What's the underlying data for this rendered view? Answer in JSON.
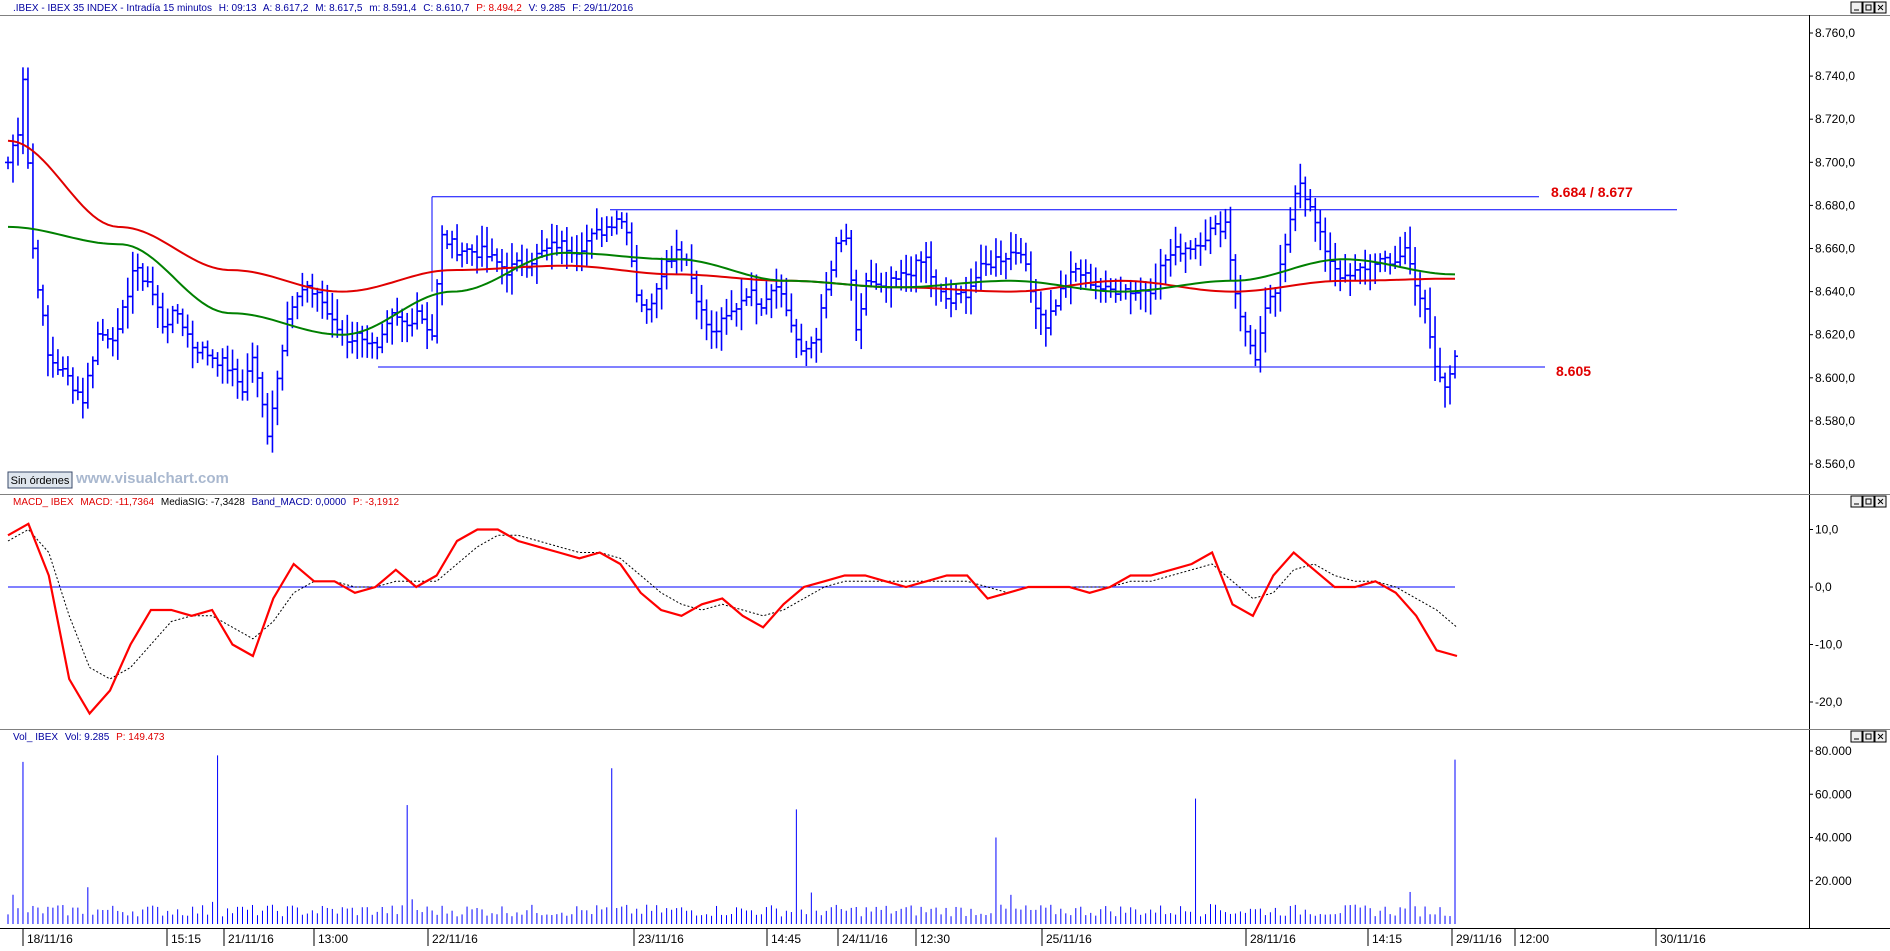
{
  "header": {
    "symbol": ".IBEX - IBEX 35 INDEX - Intradía 15 minutos",
    "h": "H: 09:13",
    "a": "A: 8.617,2",
    "m": "M: 8.617,5",
    "min": "m: 8.591,4",
    "c": "C: 8.610,7",
    "p": "P: 8.494,2",
    "v": "V: 9.285",
    "f": "F: 29/11/2016"
  },
  "watermark": "www.visualchart.com",
  "orders_button": "Sin órdenes",
  "annotations": {
    "resistance_label": "8.684 / 8.677",
    "support_label": "8.605"
  },
  "macd_header": {
    "name": "MACD_ IBEX",
    "macd": "MACD: -11,7364",
    "signal": "MediaSIG: -7,3428",
    "band": "Band_MACD: 0,0000",
    "p": "P: -3,1912"
  },
  "vol_header": {
    "name": "Vol_ IBEX",
    "vol": "Vol: 9.285",
    "p": "P: 149.473"
  },
  "x_labels": [
    "18/11/16",
    "15:15",
    "21/11/16",
    "13:00",
    "22/11/16",
    "23/11/16",
    "14:45",
    "24/11/16",
    "12:30",
    "25/11/16",
    "28/11/16",
    "14:15",
    "29/11/16",
    "12:00",
    "30/11/16"
  ],
  "colors": {
    "price": "#0000ff",
    "ma_long": "#e00000",
    "ma_short": "#008000",
    "macd": "#ff0000",
    "signal": "#000000",
    "annotation": "#e00000"
  },
  "chart_data": [
    {
      "type": "ohlc",
      "name": "IBEX 35 intraday 15 min",
      "ylim": [
        8550,
        8770
      ],
      "yticks": [
        "8.560,0",
        "8.580,0",
        "8.600,0",
        "8.620,0",
        "8.640,0",
        "8.660,0",
        "8.680,0",
        "8.700,0",
        "8.720,0",
        "8.740,0",
        "8.760,0"
      ],
      "anchors": [
        {
          "i": 0,
          "c": 8700
        },
        {
          "i": 2,
          "c": 8715
        },
        {
          "i": 3,
          "c": 8740
        },
        {
          "i": 5,
          "c": 8660
        },
        {
          "i": 8,
          "c": 8610
        },
        {
          "i": 12,
          "c": 8600
        },
        {
          "i": 15,
          "c": 8590
        },
        {
          "i": 18,
          "c": 8620
        },
        {
          "i": 22,
          "c": 8620
        },
        {
          "i": 25,
          "c": 8650
        },
        {
          "i": 28,
          "c": 8645
        },
        {
          "i": 31,
          "c": 8625
        },
        {
          "i": 34,
          "c": 8630
        },
        {
          "i": 37,
          "c": 8615
        },
        {
          "i": 41,
          "c": 8610
        },
        {
          "i": 44,
          "c": 8605
        },
        {
          "i": 47,
          "c": 8595
        },
        {
          "i": 49,
          "c": 8610
        },
        {
          "i": 52,
          "c": 8575
        },
        {
          "i": 54,
          "c": 8600
        },
        {
          "i": 56,
          "c": 8630
        },
        {
          "i": 59,
          "c": 8640
        },
        {
          "i": 62,
          "c": 8640
        },
        {
          "i": 65,
          "c": 8625
        },
        {
          "i": 68,
          "c": 8618
        },
        {
          "i": 71,
          "c": 8620
        },
        {
          "i": 74,
          "c": 8612
        },
        {
          "i": 77,
          "c": 8628
        },
        {
          "i": 80,
          "c": 8624
        },
        {
          "i": 82,
          "c": 8632
        },
        {
          "i": 85,
          "c": 8620
        },
        {
          "i": 87,
          "c": 8665
        },
        {
          "i": 90,
          "c": 8660
        },
        {
          "i": 95,
          "c": 8658
        },
        {
          "i": 100,
          "c": 8650
        },
        {
          "i": 105,
          "c": 8655
        },
        {
          "i": 110,
          "c": 8662
        },
        {
          "i": 114,
          "c": 8660
        },
        {
          "i": 117,
          "c": 8665
        },
        {
          "i": 120,
          "c": 8670
        },
        {
          "i": 122,
          "c": 8675
        },
        {
          "i": 124,
          "c": 8670
        },
        {
          "i": 126,
          "c": 8640
        },
        {
          "i": 128,
          "c": 8630
        },
        {
          "i": 131,
          "c": 8650
        },
        {
          "i": 134,
          "c": 8660
        },
        {
          "i": 136,
          "c": 8655
        },
        {
          "i": 139,
          "c": 8630
        },
        {
          "i": 141,
          "c": 8620
        },
        {
          "i": 145,
          "c": 8630
        },
        {
          "i": 148,
          "c": 8640
        },
        {
          "i": 151,
          "c": 8635
        },
        {
          "i": 154,
          "c": 8645
        },
        {
          "i": 157,
          "c": 8625
        },
        {
          "i": 159,
          "c": 8610
        },
        {
          "i": 162,
          "c": 8620
        },
        {
          "i": 164,
          "c": 8640
        },
        {
          "i": 166,
          "c": 8660
        },
        {
          "i": 168,
          "c": 8665
        },
        {
          "i": 170,
          "c": 8620
        },
        {
          "i": 172,
          "c": 8645
        },
        {
          "i": 175,
          "c": 8640
        },
        {
          "i": 178,
          "c": 8645
        },
        {
          "i": 181,
          "c": 8650
        },
        {
          "i": 184,
          "c": 8655
        },
        {
          "i": 186,
          "c": 8640
        },
        {
          "i": 189,
          "c": 8635
        },
        {
          "i": 192,
          "c": 8640
        },
        {
          "i": 195,
          "c": 8650
        },
        {
          "i": 198,
          "c": 8655
        },
        {
          "i": 201,
          "c": 8658
        },
        {
          "i": 203,
          "c": 8660
        },
        {
          "i": 205,
          "c": 8640
        },
        {
          "i": 208,
          "c": 8625
        },
        {
          "i": 211,
          "c": 8640
        },
        {
          "i": 214,
          "c": 8650
        },
        {
          "i": 217,
          "c": 8645
        },
        {
          "i": 220,
          "c": 8640
        },
        {
          "i": 223,
          "c": 8642
        },
        {
          "i": 226,
          "c": 8640
        },
        {
          "i": 229,
          "c": 8642
        },
        {
          "i": 232,
          "c": 8655
        },
        {
          "i": 235,
          "c": 8660
        },
        {
          "i": 238,
          "c": 8662
        },
        {
          "i": 241,
          "c": 8668
        },
        {
          "i": 244,
          "c": 8672
        },
        {
          "i": 246,
          "c": 8640
        },
        {
          "i": 248,
          "c": 8620
        },
        {
          "i": 250,
          "c": 8610
        },
        {
          "i": 252,
          "c": 8630
        },
        {
          "i": 254,
          "c": 8640
        },
        {
          "i": 256,
          "c": 8660
        },
        {
          "i": 258,
          "c": 8688
        },
        {
          "i": 259,
          "c": 8692
        },
        {
          "i": 261,
          "c": 8678
        },
        {
          "i": 263,
          "c": 8665
        },
        {
          "i": 265,
          "c": 8655
        },
        {
          "i": 268,
          "c": 8645
        },
        {
          "i": 271,
          "c": 8650
        },
        {
          "i": 274,
          "c": 8655
        },
        {
          "i": 277,
          "c": 8652
        },
        {
          "i": 280,
          "c": 8660
        },
        {
          "i": 282,
          "c": 8645
        },
        {
          "i": 284,
          "c": 8630
        },
        {
          "i": 286,
          "c": 8605
        },
        {
          "i": 288,
          "c": 8595
        },
        {
          "i": 290,
          "c": 8610
        }
      ],
      "ma_long": [
        8710,
        8670,
        8650,
        8640,
        8650,
        8652,
        8648,
        8645,
        8642,
        8640,
        8645,
        8640,
        8645,
        8646
      ],
      "ma_short": [
        8670,
        8662,
        8630,
        8620,
        8640,
        8658,
        8655,
        8645,
        8642,
        8645,
        8640,
        8645,
        8655,
        8648
      ],
      "resistance_lines": [
        8684,
        8678
      ],
      "support_line": 8605
    },
    {
      "type": "line",
      "name": "MACD",
      "ylim": [
        -25,
        15
      ],
      "yticks": [
        "10,0",
        "0,0",
        "-10,0",
        "-20,0"
      ],
      "series": [
        {
          "name": "MACD",
          "values": [
            9,
            11,
            2,
            -16,
            -22,
            -18,
            -10,
            -4,
            -4,
            -5,
            -4,
            -10,
            -12,
            -2,
            4,
            1,
            1,
            -1,
            0,
            3,
            0,
            2,
            8,
            10,
            10,
            8,
            7,
            6,
            5,
            6,
            4,
            -1,
            -4,
            -5,
            -3,
            -2,
            -5,
            -7,
            -3,
            0,
            1,
            2,
            2,
            1,
            0,
            1,
            2,
            2,
            -2,
            -1,
            0,
            0,
            0,
            -1,
            0,
            2,
            2,
            3,
            4,
            6,
            -3,
            -5,
            2,
            6,
            3,
            0,
            0,
            1,
            -1,
            -5,
            -11,
            -12
          ]
        },
        {
          "name": "MediaSIG",
          "values": [
            8,
            10,
            6,
            -5,
            -14,
            -16,
            -14,
            -10,
            -6,
            -5,
            -5,
            -7,
            -9,
            -6,
            -1,
            1,
            1,
            0,
            0,
            1,
            1,
            1,
            4,
            7,
            9,
            9,
            8,
            7,
            6,
            6,
            5,
            2,
            -1,
            -3,
            -4,
            -3,
            -4,
            -5,
            -4,
            -2,
            0,
            1,
            1,
            1,
            1,
            1,
            1,
            1,
            0,
            -1,
            0,
            0,
            0,
            0,
            0,
            1,
            1,
            2,
            3,
            4,
            1,
            -2,
            -1,
            3,
            4,
            2,
            1,
            1,
            0,
            -2,
            -4,
            -7
          ]
        }
      ]
    },
    {
      "type": "bar",
      "name": "Volume",
      "ylim": [
        0,
        85000
      ],
      "yticks": [
        "20.000",
        "40.000",
        "60.000",
        "80.000"
      ]
    }
  ]
}
